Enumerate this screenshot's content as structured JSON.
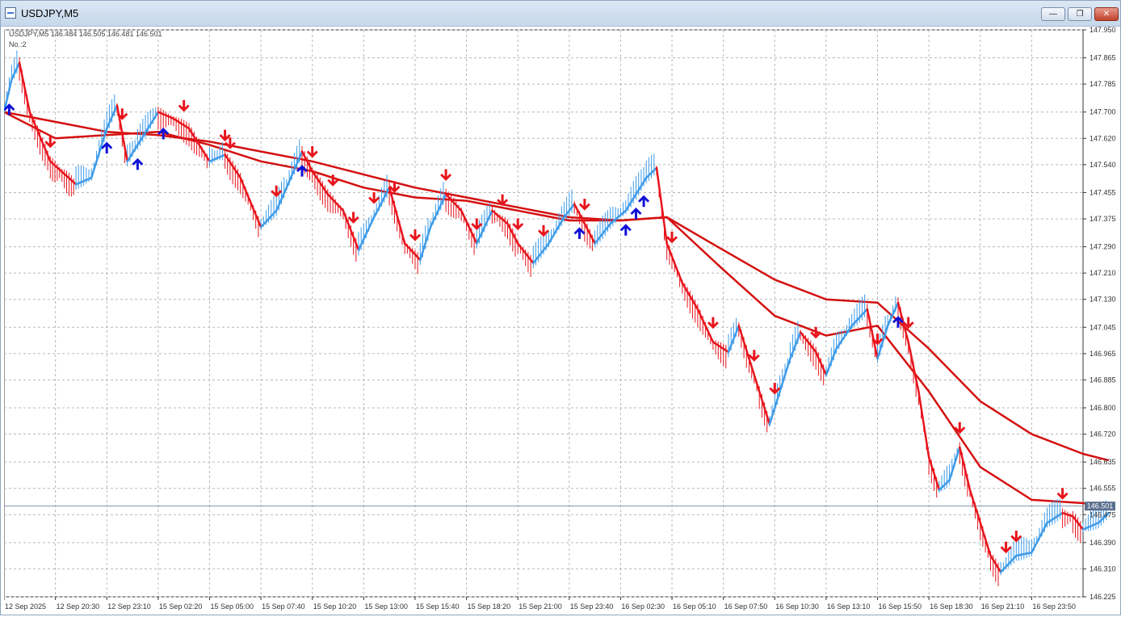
{
  "window": {
    "title": "USDJPY,M5",
    "buttons": {
      "minimize": "—",
      "restore": "❐",
      "close": "✕"
    }
  },
  "chart": {
    "header_text": "USDJPY,M5  146.484 146.505 146.481 146.501",
    "indicator_label": "No.:2",
    "current_price_label": "146.501"
  },
  "colors": {
    "up_line": "#3d9be9",
    "down_line": "#e8141c",
    "up_arrow": "#1010d8",
    "down_arrow": "#e8141c",
    "ma": "#d41010",
    "grid": "#b8b8b8"
  },
  "chart_data": {
    "type": "line",
    "symbol": "USDJPY",
    "timeframe": "M5",
    "ylim": [
      146.225,
      147.95
    ],
    "y_ticks": [
      147.95,
      147.865,
      147.785,
      147.7,
      147.62,
      147.54,
      147.455,
      147.375,
      147.29,
      147.21,
      147.13,
      147.045,
      146.965,
      146.885,
      146.8,
      146.72,
      146.635,
      146.555,
      146.475,
      146.39,
      146.31,
      146.225
    ],
    "x_ticks": [
      "12 Sep 2025",
      "12 Sep 20:30",
      "12 Sep 23:10",
      "15 Sep 02:20",
      "15 Sep 05:00",
      "15 Sep 07:40",
      "15 Sep 10:20",
      "15 Sep 13:00",
      "15 Sep 15:40",
      "15 Sep 18:20",
      "15 Sep 21:00",
      "15 Sep 23:40",
      "16 Sep 02:30",
      "16 Sep 05:10",
      "16 Sep 07:50",
      "16 Sep 10:30",
      "16 Sep 13:10",
      "16 Sep 15:50",
      "16 Sep 18:30",
      "16 Sep 21:10",
      "16 Sep 23:50"
    ],
    "current_price": 146.501,
    "series": [
      {
        "name": "",
        "values": [
          [
            0,
            147.7
          ],
          [
            0.15,
            147.8
          ],
          [
            0.3,
            147.85
          ],
          [
            0.5,
            147.7
          ],
          [
            0.9,
            147.55
          ],
          [
            1.4,
            147.48
          ],
          [
            1.7,
            147.5
          ],
          [
            2.0,
            147.65
          ],
          [
            2.2,
            147.72
          ],
          [
            2.4,
            147.55
          ],
          [
            2.6,
            147.6
          ],
          [
            3.0,
            147.7
          ],
          [
            3.3,
            147.68
          ],
          [
            3.6,
            147.65
          ],
          [
            4.0,
            147.55
          ],
          [
            4.3,
            147.57
          ],
          [
            4.6,
            147.5
          ],
          [
            5.0,
            147.35
          ],
          [
            5.3,
            147.4
          ],
          [
            5.5,
            147.47
          ],
          [
            5.8,
            147.58
          ],
          [
            6.0,
            147.52
          ],
          [
            6.3,
            147.45
          ],
          [
            6.6,
            147.4
          ],
          [
            6.9,
            147.28
          ],
          [
            7.2,
            147.38
          ],
          [
            7.5,
            147.47
          ],
          [
            7.8,
            147.3
          ],
          [
            8.1,
            147.25
          ],
          [
            8.3,
            147.35
          ],
          [
            8.6,
            147.45
          ],
          [
            8.9,
            147.4
          ],
          [
            9.2,
            147.3
          ],
          [
            9.5,
            147.4
          ],
          [
            9.8,
            147.36
          ],
          [
            10.0,
            147.3
          ],
          [
            10.3,
            147.24
          ],
          [
            10.6,
            147.3
          ],
          [
            10.9,
            147.38
          ],
          [
            11.1,
            147.42
          ],
          [
            11.3,
            147.36
          ],
          [
            11.5,
            147.3
          ],
          [
            11.8,
            147.36
          ],
          [
            12.1,
            147.4
          ],
          [
            12.5,
            147.5
          ],
          [
            12.7,
            147.53
          ],
          [
            12.9,
            147.3
          ],
          [
            13.2,
            147.18
          ],
          [
            13.5,
            147.1
          ],
          [
            13.8,
            147.0
          ],
          [
            14.1,
            146.97
          ],
          [
            14.3,
            147.05
          ],
          [
            14.5,
            146.95
          ],
          [
            14.7,
            146.85
          ],
          [
            14.9,
            146.75
          ],
          [
            15.1,
            146.85
          ],
          [
            15.3,
            146.95
          ],
          [
            15.5,
            147.03
          ],
          [
            15.8,
            146.97
          ],
          [
            16.0,
            146.9
          ],
          [
            16.2,
            146.98
          ],
          [
            16.5,
            147.05
          ],
          [
            16.8,
            147.1
          ],
          [
            17.0,
            146.95
          ],
          [
            17.2,
            147.05
          ],
          [
            17.4,
            147.12
          ],
          [
            17.6,
            147.0
          ],
          [
            17.8,
            146.85
          ],
          [
            18.0,
            146.65
          ],
          [
            18.2,
            146.55
          ],
          [
            18.4,
            146.58
          ],
          [
            18.6,
            146.68
          ],
          [
            18.8,
            146.55
          ],
          [
            19.0,
            146.45
          ],
          [
            19.2,
            146.35
          ],
          [
            19.4,
            146.3
          ],
          [
            19.7,
            146.35
          ],
          [
            20.0,
            146.36
          ],
          [
            20.3,
            146.45
          ],
          [
            20.6,
            146.48
          ],
          [
            20.8,
            146.47
          ],
          [
            21.0,
            146.43
          ],
          [
            21.3,
            146.45
          ],
          [
            21.5,
            146.48
          ]
        ]
      },
      {
        "name": "",
        "values": [
          [
            0,
            147.7
          ],
          [
            1,
            147.62
          ],
          [
            2,
            147.63
          ],
          [
            3,
            147.64
          ],
          [
            4,
            147.6
          ],
          [
            5,
            147.55
          ],
          [
            6,
            147.52
          ],
          [
            7,
            147.47
          ],
          [
            8,
            147.44
          ],
          [
            9,
            147.43
          ],
          [
            10,
            147.4
          ],
          [
            11,
            147.37
          ],
          [
            12,
            147.37
          ],
          [
            12.9,
            147.38
          ],
          [
            14,
            147.22
          ],
          [
            15,
            147.08
          ],
          [
            16,
            147.02
          ],
          [
            17,
            147.05
          ],
          [
            18,
            146.85
          ],
          [
            19,
            146.62
          ],
          [
            20,
            146.52
          ],
          [
            21,
            146.51
          ],
          [
            21.5,
            146.5
          ]
        ]
      },
      {
        "name": "",
        "values": [
          [
            0,
            147.7
          ],
          [
            1,
            147.67
          ],
          [
            2,
            147.64
          ],
          [
            3,
            147.63
          ],
          [
            4,
            147.61
          ],
          [
            5,
            147.58
          ],
          [
            6,
            147.55
          ],
          [
            7,
            147.51
          ],
          [
            8,
            147.47
          ],
          [
            9,
            147.44
          ],
          [
            10,
            147.41
          ],
          [
            11,
            147.38
          ],
          [
            12,
            147.37
          ],
          [
            12.9,
            147.38
          ],
          [
            14,
            147.28
          ],
          [
            15,
            147.19
          ],
          [
            16,
            147.13
          ],
          [
            17,
            147.12
          ],
          [
            18,
            146.98
          ],
          [
            19,
            146.82
          ],
          [
            20,
            146.72
          ],
          [
            21,
            146.66
          ],
          [
            21.5,
            146.64
          ]
        ]
      }
    ],
    "down_arrow_x": [
      0.9,
      2.3,
      3.5,
      4.3,
      4.4,
      5.3,
      6.0,
      6.4,
      6.8,
      7.2,
      7.6,
      8.0,
      8.6,
      9.2,
      9.7,
      10.0,
      10.5,
      11.3,
      13.0,
      13.8,
      14.6,
      15.0,
      15.8,
      17.0,
      17.6,
      18.6,
      19.5,
      19.7,
      20.6
    ],
    "up_arrow_x": [
      0.1,
      2.0,
      2.6,
      3.1,
      5.8,
      11.2,
      12.1,
      12.3,
      12.45,
      17.4
    ]
  }
}
